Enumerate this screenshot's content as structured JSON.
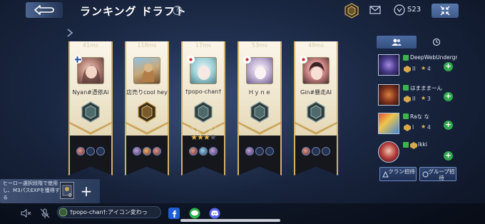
{
  "header": {
    "title": "ランキング ドラフト",
    "help": "?",
    "season": "S23"
  },
  "players": [
    {
      "timer": "41ms",
      "name": "Nyan#憑依Ai",
      "hero_label": "",
      "stars": "",
      "flag": "finland"
    },
    {
      "timer": "118ms",
      "name": "店売りcool hey",
      "hero_label": "",
      "stars": "",
      "flag": "none"
    },
    {
      "timer": "17ms",
      "name": "†popo-chan†",
      "hero_label": "エピック I",
      "stars": "★★★",
      "stars_dim": "★",
      "flag": "japan"
    },
    {
      "timer": "53ms",
      "name": "Ｈｙｎｅ",
      "hero_label": "",
      "stars": "",
      "flag": "japan"
    },
    {
      "timer": "49ms",
      "name": "Gin#暴走AI",
      "hero_label": "",
      "stars": "",
      "flag": "japan"
    }
  ],
  "friends": [
    {
      "name": "DeepWebUnderground",
      "tier": "II",
      "count": "4"
    },
    {
      "name": "はまままーん",
      "tier": "II",
      "count": "3"
    },
    {
      "name": "Raな な",
      "tier": "I",
      "count": "4"
    },
    {
      "name": "Ikki",
      "tier": "",
      "count": ""
    }
  ],
  "panel_buttons": {
    "clan_invite": "クラン招待",
    "group_invite": "グループ招待"
  },
  "team_box": {
    "text": "ヒーロー選択段階で使用し、M3パスEXPを獲得する",
    "count": "0",
    "add": "+"
  },
  "chat": {
    "message": "†popo-chan†:アイコン変わっ"
  },
  "colors": {
    "banner_gold": "#d2b26b",
    "banner_cream": "#fbf6e9",
    "accent_blue": "#4c6aa1",
    "invite_green": "#2fa84d",
    "star_gold": "#e9b64a"
  }
}
